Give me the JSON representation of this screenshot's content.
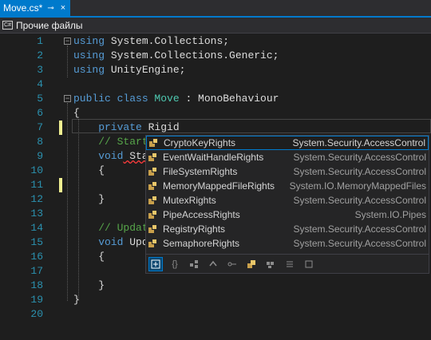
{
  "tab": {
    "title": "Move.cs*",
    "pin": "⊸",
    "close": "×"
  },
  "nav": {
    "icon": "C#",
    "project": "Прочие файлы"
  },
  "lines": [
    "1",
    "2",
    "3",
    "4",
    "5",
    "6",
    "7",
    "8",
    "9",
    "10",
    "11",
    "12",
    "13",
    "14",
    "15",
    "16",
    "17",
    "18",
    "19",
    "20"
  ],
  "code": {
    "l1a": "using",
    "l1b": " System.Collections;",
    "l2a": "using",
    "l2b": " System.Collections.Generic;",
    "l3a": "using",
    "l3b": " UnityEngine;",
    "l5a": "public",
    "l5b": " class ",
    "l5c": "Move",
    "l5d": " : MonoBehaviour",
    "l6": "{",
    "l7a": "    private",
    "l7b": " Rigid",
    "l8": "    // Start",
    "l9a": "    void",
    "l9b": " Sta",
    "l10": "    {",
    "l12": "    }",
    "l14": "    // Updat",
    "l15a": "    void",
    "l15b": " Upd",
    "l16": "    {",
    "l18": "    }",
    "l19": "}"
  },
  "completion": {
    "items": [
      {
        "name": "CryptoKeyRights",
        "ns": "System.Security.AccessControl"
      },
      {
        "name": "EventWaitHandleRights",
        "ns": "System.Security.AccessControl"
      },
      {
        "name": "FileSystemRights",
        "ns": "System.Security.AccessControl"
      },
      {
        "name": "MemoryMappedFileRights",
        "ns": "System.IO.MemoryMappedFiles"
      },
      {
        "name": "MutexRights",
        "ns": "System.Security.AccessControl"
      },
      {
        "name": "PipeAccessRights",
        "ns": "System.IO.Pipes"
      },
      {
        "name": "RegistryRights",
        "ns": "System.Security.AccessControl"
      },
      {
        "name": "SemaphoreRights",
        "ns": "System.Security.AccessControl"
      }
    ],
    "filter_icons": [
      "expand-icon",
      "namespace-icon",
      "class-icon",
      "delegate-icon",
      "interface-icon",
      "enum-icon",
      "struct-icon",
      "snippet-icon",
      "keyword-icon",
      "local-icon",
      "field-icon"
    ]
  },
  "colors": {
    "accent": "#007acc",
    "keyword": "#569cd6",
    "type": "#4ec9b0",
    "comment": "#57a64a",
    "line_number": "#2b91af"
  }
}
